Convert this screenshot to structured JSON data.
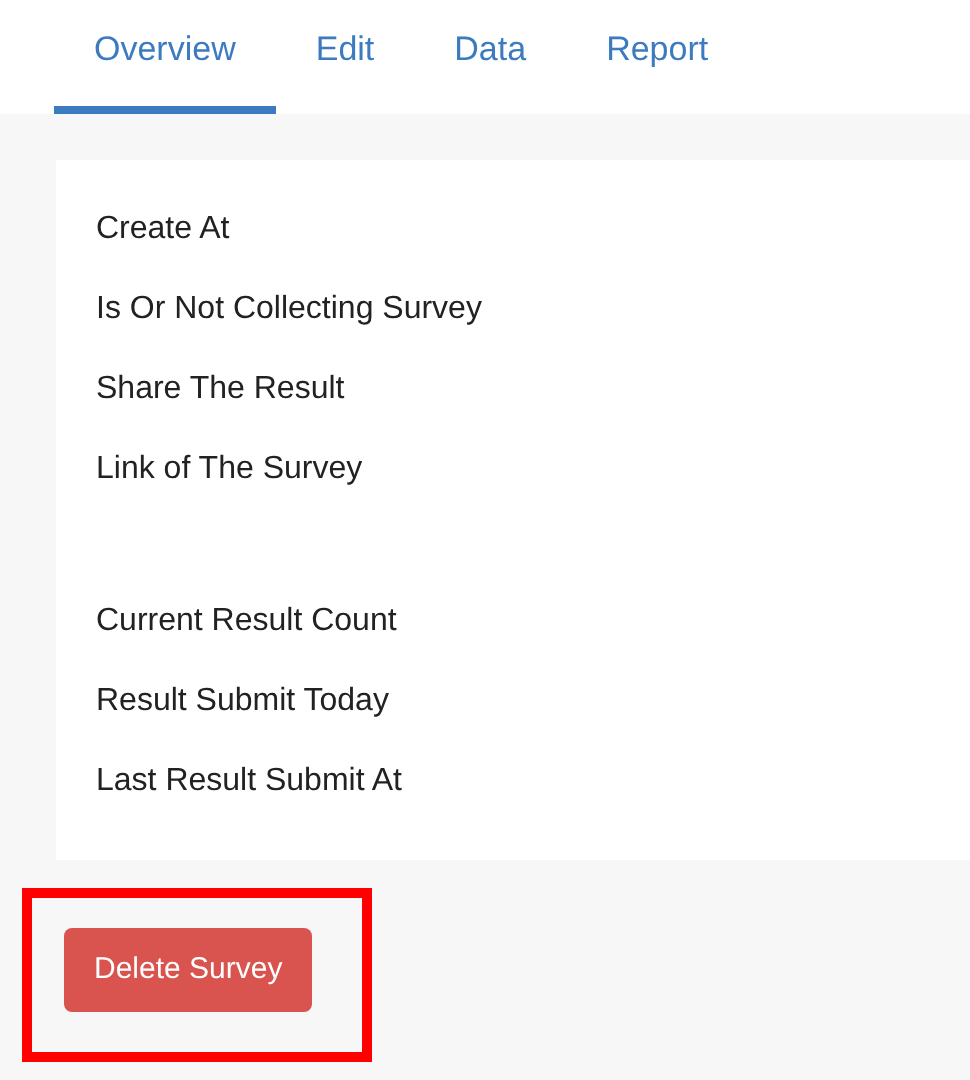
{
  "tabs": [
    {
      "label": "Overview",
      "selected": true
    },
    {
      "label": "Edit",
      "selected": false
    },
    {
      "label": "Data",
      "selected": false
    },
    {
      "label": "Report",
      "selected": false
    }
  ],
  "sections": [
    {
      "rows": [
        "Create At",
        "Is Or Not Collecting Survey",
        "Share The Result",
        "Link of The Survey"
      ]
    },
    {
      "rows": [
        "Current Result Count",
        "Result Submit Today",
        "Last Result Submit At"
      ]
    }
  ],
  "delete_button": {
    "label": "Delete Survey",
    "highlighted": true
  }
}
